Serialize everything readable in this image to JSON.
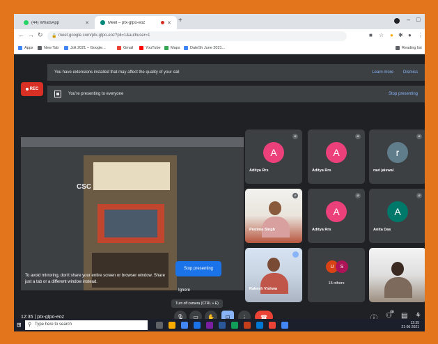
{
  "browser": {
    "tabs": [
      {
        "title": "(44) WhatsApp",
        "favicon_color": "#25d366",
        "active": false
      },
      {
        "title": "Meet – ptx-gtpo-eoz",
        "favicon_color": "#00897b",
        "active": true
      }
    ],
    "url": "meet.google.com/ptx-gtpo-eoz?pli=1&authuser=1",
    "bookmarks": [
      {
        "label": "Apps",
        "color": "#4285f4"
      },
      {
        "label": "New Tab",
        "color": "#5f6368"
      },
      {
        "label": "Jolt 2021 – Google...",
        "color": "#4285f4"
      },
      {
        "label": "Gmail",
        "color": "#ea4335"
      },
      {
        "label": "YouTube",
        "color": "#ff0000"
      },
      {
        "label": "Maps",
        "color": "#34a853"
      },
      {
        "label": "DateSh June 2021...",
        "color": "#4285f4"
      }
    ],
    "reading_list": "Reading list"
  },
  "meet": {
    "rec_label": "REC",
    "extension_banner": {
      "text": "You have extensions installed that may affect the quality of your call",
      "learn_more": "Learn more",
      "dismiss": "Dismiss"
    },
    "presenting_banner": {
      "text": "You're presenting to everyone",
      "stop": "Stop presenting"
    },
    "presentation": {
      "logo_text": "CSC",
      "mirror_warning": "To avoid mirroring, don't share your entire screen or browser window. Share just a tab or a different window instead.",
      "stop_button": "Stop presenting",
      "ignore": "Ignore"
    },
    "participants": [
      {
        "name": "Aditya Rrs",
        "initial": "A",
        "color": "#ec407a"
      },
      {
        "name": "Aditya Rrs",
        "initial": "A",
        "color": "#ec407a"
      },
      {
        "name": "ravi jaiswal",
        "initial": "r",
        "color": "#607d8b"
      },
      {
        "name": "Pratima Singh",
        "video": true
      },
      {
        "name": "Aditya Rrs",
        "initial": "A",
        "color": "#ec407a"
      },
      {
        "name": "Anita Das",
        "initial": "A",
        "color": "#00796b"
      },
      {
        "name": "Rakesh Vishwa",
        "video": true
      },
      {
        "name": "15 others",
        "others": true
      },
      {
        "name": "",
        "video": true
      }
    ],
    "others_initials": [
      "U",
      "S"
    ],
    "meeting_time": "12:35",
    "meeting_code": "ptx-gtpo-eoz",
    "tooltip": "Turn off camera (CTRL + E)",
    "people_count": "18"
  },
  "taskbar": {
    "search_placeholder": "Type here to search",
    "time": "12:35",
    "date": "21-06-2021"
  }
}
